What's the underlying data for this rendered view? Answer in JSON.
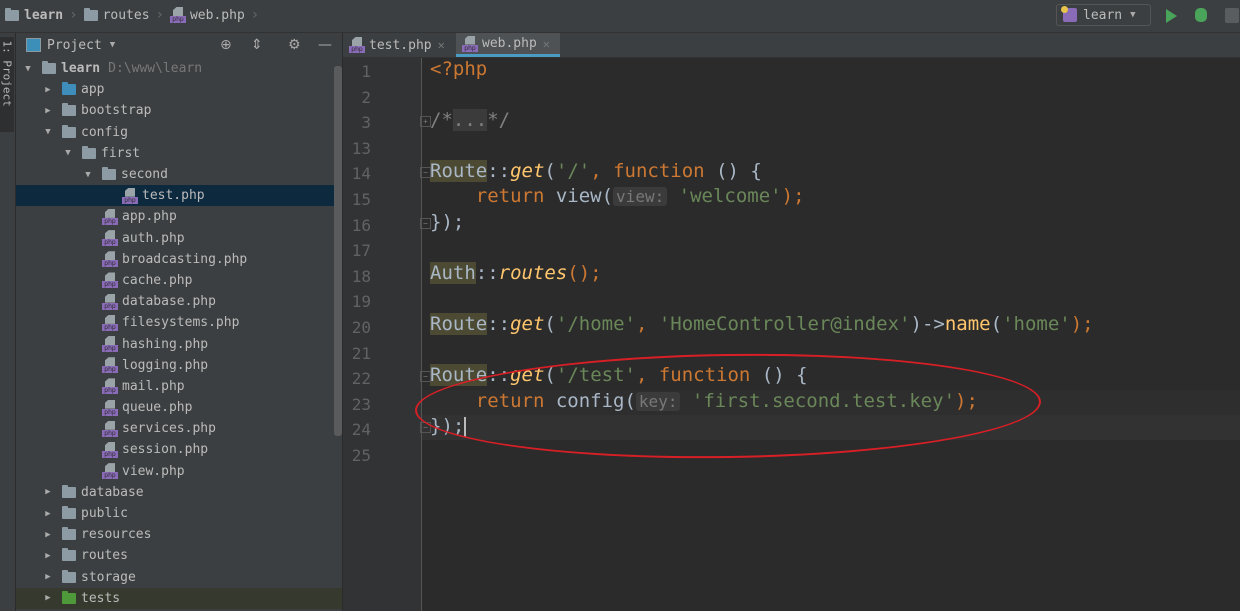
{
  "breadcrumb": [
    {
      "label": "learn",
      "icon": "folder-icon"
    },
    {
      "label": "routes",
      "icon": "folder-icon"
    },
    {
      "label": "web.php",
      "icon": "php-file-icon"
    }
  ],
  "toolbar": {
    "run_config": "learn",
    "run_icon": "play-icon",
    "debug_icon": "bug-icon",
    "coverage_icon": "coverage-icon"
  },
  "left_strip": {
    "label": "1: Project"
  },
  "project_panel": {
    "title": "Project",
    "tree": [
      {
        "label": "learn",
        "path": "D:\\www\\learn",
        "expanded": true,
        "type": "folder",
        "depth": 0
      },
      {
        "label": "app",
        "type": "folder-blue",
        "depth": 1,
        "expanded": false
      },
      {
        "label": "bootstrap",
        "type": "folder",
        "depth": 1,
        "expanded": false
      },
      {
        "label": "config",
        "type": "folder",
        "depth": 1,
        "expanded": true
      },
      {
        "label": "first",
        "type": "folder",
        "depth": 2,
        "expanded": true
      },
      {
        "label": "second",
        "type": "folder",
        "depth": 3,
        "expanded": true
      },
      {
        "label": "test.php",
        "type": "php",
        "depth": 4,
        "selected": true
      },
      {
        "label": "app.php",
        "type": "php",
        "depth": 3
      },
      {
        "label": "auth.php",
        "type": "php",
        "depth": 3
      },
      {
        "label": "broadcasting.php",
        "type": "php",
        "depth": 3
      },
      {
        "label": "cache.php",
        "type": "php",
        "depth": 3
      },
      {
        "label": "database.php",
        "type": "php",
        "depth": 3
      },
      {
        "label": "filesystems.php",
        "type": "php",
        "depth": 3
      },
      {
        "label": "hashing.php",
        "type": "php",
        "depth": 3
      },
      {
        "label": "logging.php",
        "type": "php",
        "depth": 3
      },
      {
        "label": "mail.php",
        "type": "php",
        "depth": 3
      },
      {
        "label": "queue.php",
        "type": "php",
        "depth": 3
      },
      {
        "label": "services.php",
        "type": "php",
        "depth": 3
      },
      {
        "label": "session.php",
        "type": "php",
        "depth": 3
      },
      {
        "label": "view.php",
        "type": "php",
        "depth": 3
      },
      {
        "label": "database",
        "type": "folder",
        "depth": 1,
        "expanded": false
      },
      {
        "label": "public",
        "type": "folder",
        "depth": 1,
        "expanded": false
      },
      {
        "label": "resources",
        "type": "folder",
        "depth": 1,
        "expanded": false
      },
      {
        "label": "routes",
        "type": "folder",
        "depth": 1,
        "expanded": false
      },
      {
        "label": "storage",
        "type": "folder",
        "depth": 1,
        "expanded": false
      },
      {
        "label": "tests",
        "type": "folder-green",
        "depth": 1,
        "expanded": false
      }
    ]
  },
  "editor_tabs": [
    {
      "label": "test.php",
      "active": false
    },
    {
      "label": "web.php",
      "active": true
    }
  ],
  "editor": {
    "line_numbers": [
      "1",
      "2",
      "3",
      "13",
      "14",
      "15",
      "16",
      "17",
      "18",
      "19",
      "20",
      "21",
      "22",
      "23",
      "24",
      "25"
    ],
    "lines": {
      "l1": {
        "tag": "<?php"
      },
      "l3": {
        "open": "/*",
        "fold": "...",
        "close": "*/"
      },
      "l14": {
        "cls": "Route",
        "sep": "::",
        "fn": "get",
        "p1": "(",
        "s1": "'/'",
        "c1": ", ",
        "kw": "function",
        "rest": " () {"
      },
      "l15": {
        "indent": "    ",
        "kw": "return",
        "mid": " view(",
        "hint": "view:",
        "s": "'welcome'",
        "end": ");"
      },
      "l16": {
        "text": "});"
      },
      "l18": {
        "cls": "Auth",
        "sep": "::",
        "fn": "routes",
        "end": "();"
      },
      "l20": {
        "cls": "Route",
        "sep": "::",
        "fn": "get",
        "p1": "(",
        "s1": "'/home'",
        "c1": ", ",
        "s2": "'HomeController@index'",
        "arrow": ")->",
        "meth": "name",
        "p2": "(",
        "s3": "'home'",
        "end": ");"
      },
      "l22": {
        "cls": "Route",
        "sep": "::",
        "fn": "get",
        "p1": "(",
        "s1": "'/test'",
        "c1": ", ",
        "kw": "function",
        "rest": " () {"
      },
      "l23": {
        "indent": "    ",
        "kw": "return",
        "mid": " config(",
        "hint": "key:",
        "s": "'first.second.test.key'",
        "end": ");"
      },
      "l24": {
        "text": "});"
      }
    }
  },
  "browser_icons": [
    "chrome-icon",
    "firefox-icon",
    "safari-icon",
    "opera-icon"
  ]
}
